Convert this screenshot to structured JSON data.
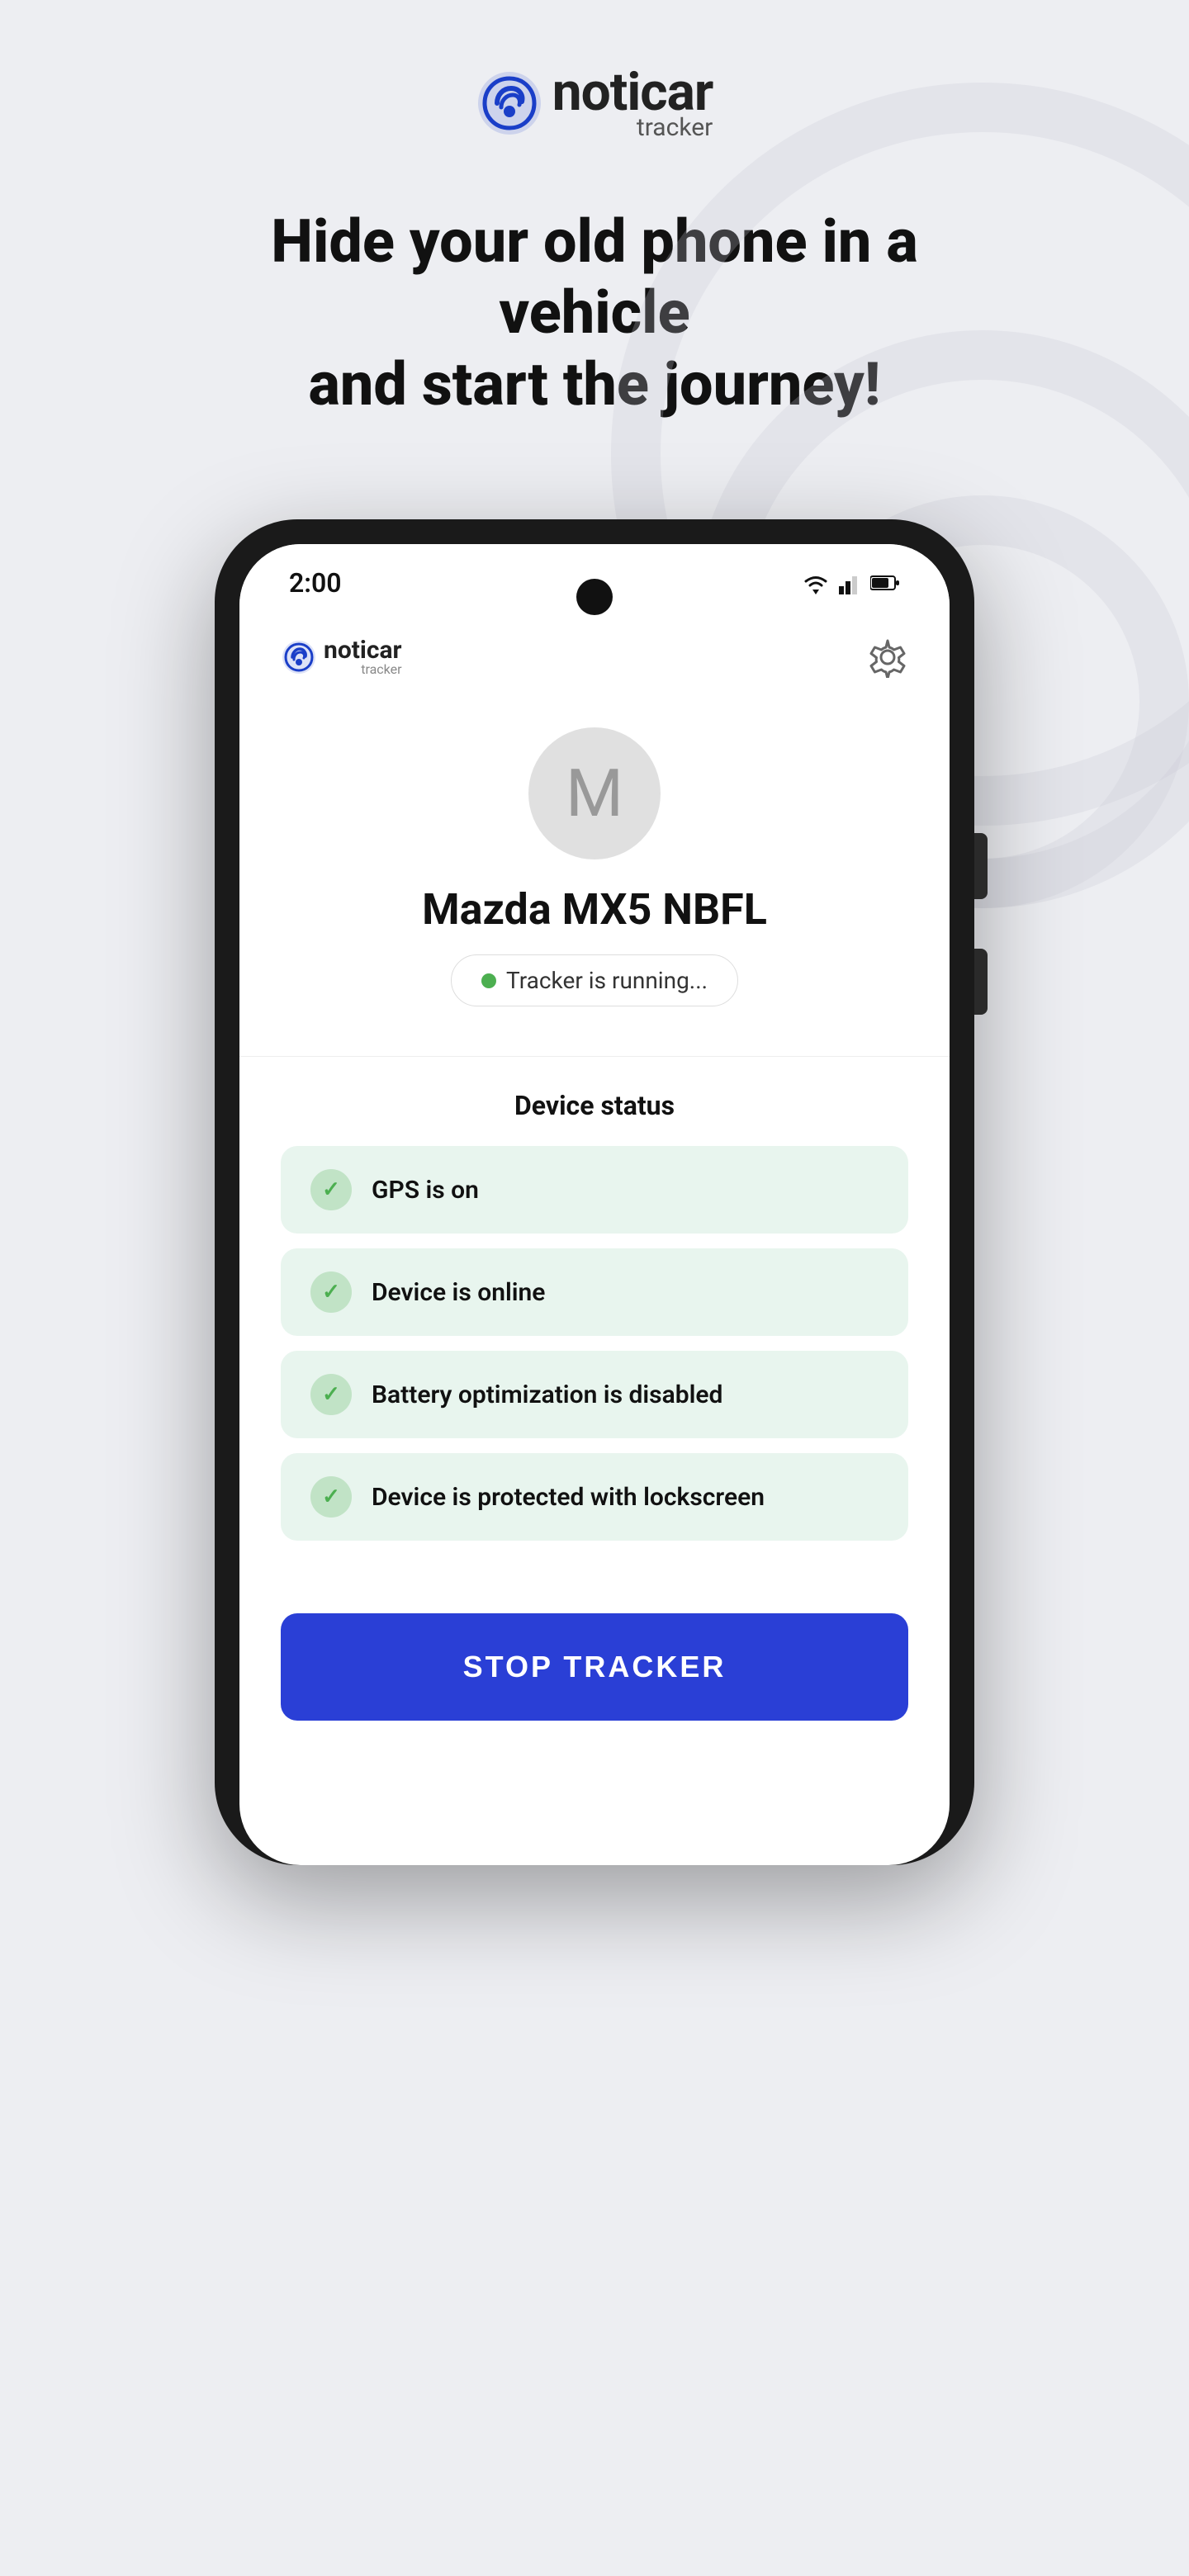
{
  "app": {
    "logo_name": "noticar",
    "logo_subtitle": "tracker"
  },
  "hero": {
    "heading_line1": "Hide your old phone in a vehicle",
    "heading_line2": "and start the journey!"
  },
  "phone": {
    "status_bar": {
      "time": "2:00"
    },
    "header": {
      "logo_name": "noticar",
      "logo_subtitle": "tracker"
    },
    "vehicle": {
      "avatar_letter": "M",
      "name": "Mazda MX5 NBFL",
      "tracker_status": "Tracker is running..."
    },
    "device_status": {
      "title": "Device status",
      "items": [
        {
          "text": "GPS is on"
        },
        {
          "text": "Device is online"
        },
        {
          "text": "Battery optimization is disabled"
        },
        {
          "text": "Device is protected with lockscreen"
        }
      ]
    },
    "stop_button": {
      "label": "STOP TRACKER"
    }
  }
}
